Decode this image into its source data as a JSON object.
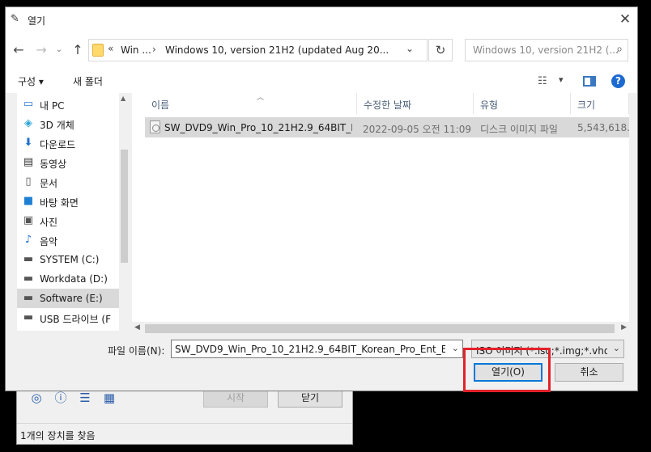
{
  "background_window": {
    "start_label": "시작",
    "close_label": "닫기",
    "status": "1개의 장치를 찾음"
  },
  "dialog": {
    "title": "열기",
    "close": "✕"
  },
  "address": {
    "chevrons": "«",
    "crumb1": "Win ...",
    "separator": "›",
    "crumb2": "Windows 10, version 21H2 (updated Aug 20...",
    "search_placeholder": "Windows 10, version 21H2 (..."
  },
  "commands": {
    "organize": "구성 ▾",
    "new_folder": "새 폴더",
    "help": "?"
  },
  "nav_items": [
    {
      "label": "내 PC",
      "icon": "computer-icon"
    },
    {
      "label": "3D 개체",
      "icon": "3d-objects-icon"
    },
    {
      "label": "다운로드",
      "icon": "download-icon"
    },
    {
      "label": "동영상",
      "icon": "video-icon"
    },
    {
      "label": "문서",
      "icon": "document-icon"
    },
    {
      "label": "바탕 화면",
      "icon": "desktop-icon"
    },
    {
      "label": "사진",
      "icon": "pictures-icon"
    },
    {
      "label": "음악",
      "icon": "music-icon"
    },
    {
      "label": "SYSTEM (C:)",
      "icon": "drive-icon"
    },
    {
      "label": "Workdata (D:)",
      "icon": "drive-icon"
    },
    {
      "label": "Software (E:)",
      "icon": "drive-icon"
    },
    {
      "label": "USB 드라이브 (F",
      "icon": "usb-drive-icon"
    }
  ],
  "columns": {
    "name": "이름",
    "modified": "수정한 날짜",
    "type": "유형",
    "size": "크기"
  },
  "files": [
    {
      "name": "SW_DVD9_Win_Pro_10_21H2.9_64BIT_K...",
      "modified": "2022-09-05 오전 11:09",
      "type": "디스크 이미지 파일",
      "size": "5,543,618..."
    }
  ],
  "bottom": {
    "filename_label": "파일 이름(N):",
    "filename_value": "SW_DVD9_Win_Pro_10_21H2.9_64BIT_Korean_Pro_Ent_EDU_N_",
    "filetype_value": "ISO 이미지 (*.iso;*.img;*.vhd;*.",
    "open_label": "열기(O)",
    "cancel_label": "취소"
  },
  "colors": {
    "highlight": "#e3212a",
    "accent": "#0078d7"
  }
}
